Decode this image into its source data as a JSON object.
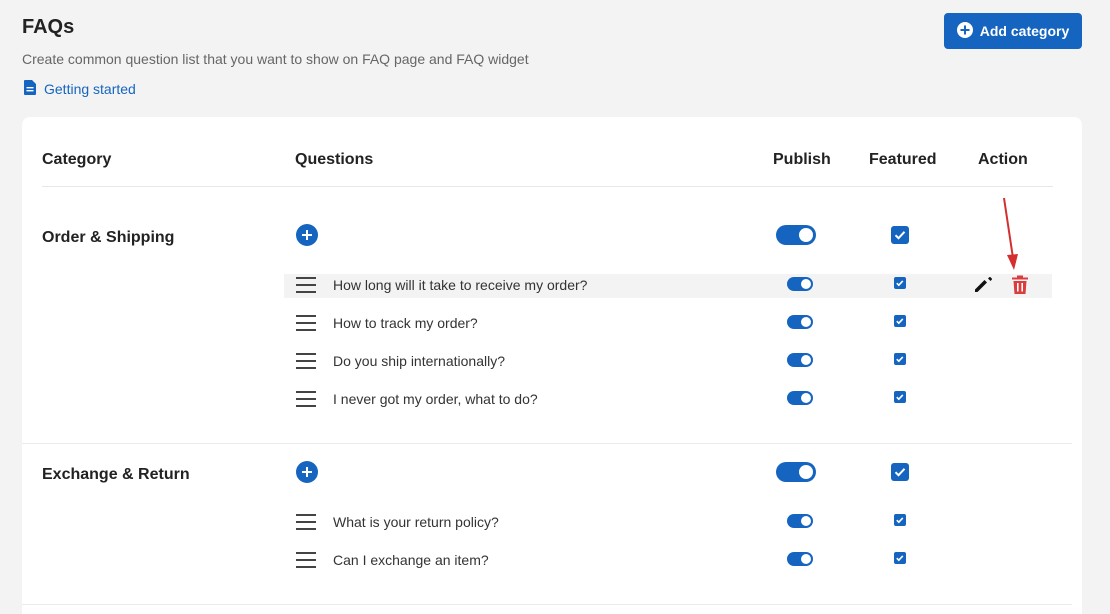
{
  "header": {
    "title": "FAQs",
    "subtitle": "Create common question list that you want to show on FAQ page and FAQ widget",
    "getting_started": "Getting started",
    "add_category": "Add category"
  },
  "table": {
    "columns": {
      "category": "Category",
      "questions": "Questions",
      "publish": "Publish",
      "featured": "Featured",
      "action": "Action"
    }
  },
  "categories": [
    {
      "name": "Order & Shipping",
      "published": true,
      "featured": true,
      "questions": [
        {
          "text": "How long will it take to receive my order?",
          "published": true,
          "featured": true,
          "hovered": true
        },
        {
          "text": "How to track my order?",
          "published": true,
          "featured": true
        },
        {
          "text": "Do you ship internationally?",
          "published": true,
          "featured": true
        },
        {
          "text": "I never got my order, what to do?",
          "published": true,
          "featured": true
        }
      ]
    },
    {
      "name": "Exchange & Return",
      "published": true,
      "featured": true,
      "questions": [
        {
          "text": "What is your return policy?",
          "published": true,
          "featured": true
        },
        {
          "text": "Can I exchange an item?",
          "published": true,
          "featured": true
        }
      ]
    }
  ],
  "icons": {
    "getting_started": "document-icon",
    "add_category": "plus-circle-icon",
    "edit": "pencil-icon",
    "delete": "trash-icon",
    "drag": "drag-handle-icon"
  },
  "colors": {
    "primary": "#1565c0",
    "danger": "#d93d3d",
    "annotation_arrow": "#d32f2f"
  }
}
